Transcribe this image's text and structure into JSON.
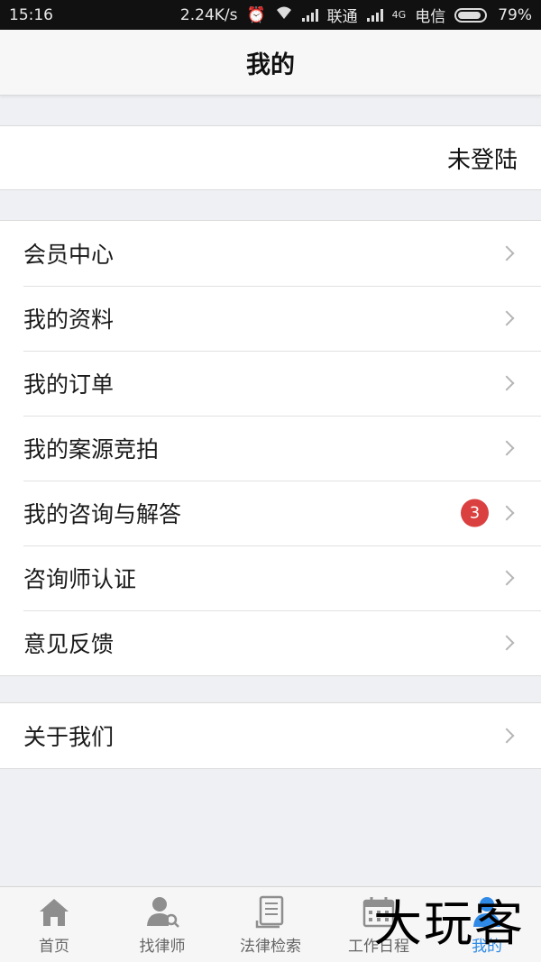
{
  "status_bar": {
    "time": "15:16",
    "speed": "2.24K/s",
    "carrier1": "联通",
    "carrier2": "电信",
    "network_type": "4G",
    "battery": "79%"
  },
  "header": {
    "title": "我的"
  },
  "login": {
    "text": "未登陆"
  },
  "menu": {
    "items": [
      {
        "label": "会员中心"
      },
      {
        "label": "我的资料"
      },
      {
        "label": "我的订单"
      },
      {
        "label": "我的案源竞拍"
      },
      {
        "label": "我的咨询与解答",
        "badge": "3"
      },
      {
        "label": "咨询师认证"
      },
      {
        "label": "意见反馈"
      }
    ],
    "about": {
      "label": "关于我们"
    }
  },
  "tabbar": {
    "accent": "#2e8ae6",
    "tabs": [
      {
        "label": "首页",
        "icon": "home-icon"
      },
      {
        "label": "找律师",
        "icon": "find-lawyer-icon"
      },
      {
        "label": "法律检索",
        "icon": "law-search-icon"
      },
      {
        "label": "工作日程",
        "icon": "calendar-icon"
      },
      {
        "label": "我的",
        "icon": "profile-icon",
        "active": true
      }
    ]
  },
  "watermark": {
    "text": "大玩客"
  }
}
